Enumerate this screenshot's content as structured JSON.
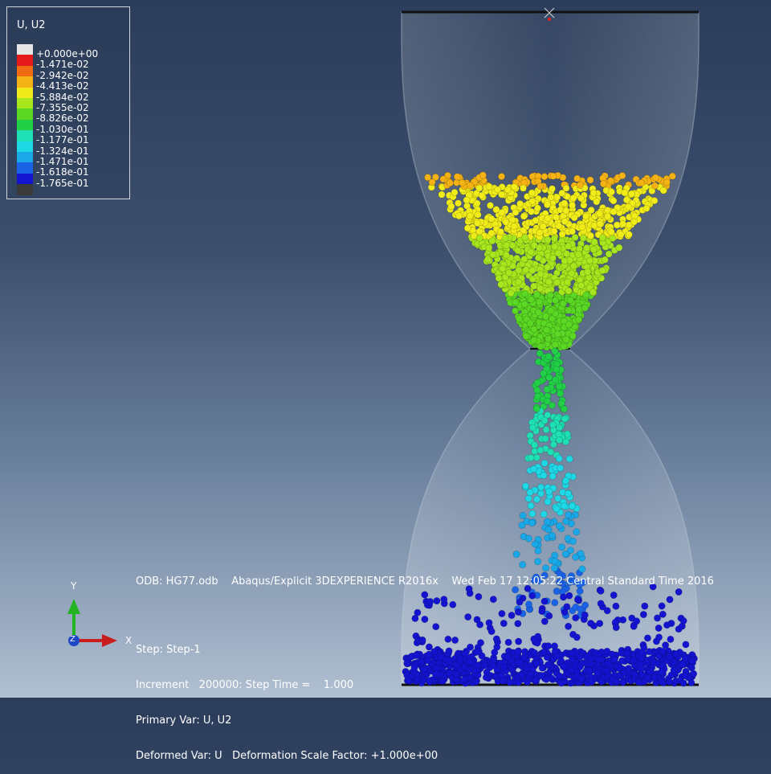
{
  "legend": {
    "title": "U, U2",
    "entries": [
      {
        "label": "+0.000e+00",
        "color": "#e6e6e6"
      },
      {
        "label": "-1.471e-02",
        "color": "#e41a1a"
      },
      {
        "label": "-2.942e-02",
        "color": "#f06a12"
      },
      {
        "label": "-4.413e-02",
        "color": "#f4b214"
      },
      {
        "label": "-5.884e-02",
        "color": "#f0ec1a"
      },
      {
        "label": "-7.355e-02",
        "color": "#a8e61e"
      },
      {
        "label": "-8.826e-02",
        "color": "#5ad824"
      },
      {
        "label": "-1.030e-01",
        "color": "#22d048"
      },
      {
        "label": "-1.177e-01",
        "color": "#1ee0b4"
      },
      {
        "label": "-1.324e-01",
        "color": "#1ed8e6"
      },
      {
        "label": "-1.471e-01",
        "color": "#1aa8e8"
      },
      {
        "label": "-1.618e-01",
        "color": "#1a62e6"
      },
      {
        "label": "-1.765e-01",
        "color": "#1414d0"
      },
      {
        "label": "",
        "color": "#3a3a3a"
      }
    ]
  },
  "info": {
    "odb": "ODB: HG77.odb",
    "solver": "Abaqus/Explicit 3DEXPERIENCE R2016x",
    "date": "Wed Feb 17 12:05:22 Central Standard Time 2016"
  },
  "step": {
    "step_line": "Step: Step-1",
    "increment_line": "Increment   200000: Step Time =    1.000",
    "primary_line": "Primary Var: U, U2",
    "deformed_line": "Deformed Var: U   Deformation Scale Factor: +1.000e+00"
  },
  "triad": {
    "y_label": "Y",
    "x_label": "X",
    "z_label": "Z"
  },
  "colors": {
    "y_axis": "#23b423",
    "x_axis": "#c81e1e",
    "z_axis": "#1e46c8"
  }
}
